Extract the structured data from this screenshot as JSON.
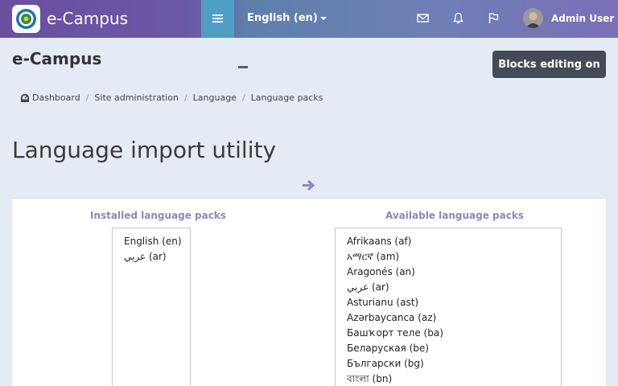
{
  "navbar": {
    "brand": "e-Campus",
    "language_menu": "English (en)",
    "user_name": "Admin User"
  },
  "header": {
    "site_title": "e-Campus",
    "blocks_button": "Blocks editing on"
  },
  "breadcrumb": [
    {
      "label": "Dashboard"
    },
    {
      "label": "Site administration"
    },
    {
      "label": "Language"
    },
    {
      "label": "Language packs"
    }
  ],
  "main": {
    "heading": "Language import utility",
    "installed": {
      "title": "Installed language packs",
      "items": [
        "English (en)",
        "عربي (ar)"
      ]
    },
    "available": {
      "title": "Available language packs",
      "items": [
        "Afrikaans (af)",
        "አማርኛ (am)",
        "Aragonés (an)",
        "عربي (ar)",
        "Asturianu (ast)",
        "Azərbaycanca (az)",
        "Башҡорт теле (ba)",
        "Беларуская (be)",
        "Български (bg)",
        "বাংলা (bn)"
      ]
    }
  },
  "icons": {
    "nav_toggle": "hamburger-icon",
    "messages": "envelope-icon",
    "notifications": "bell-icon",
    "flag": "flag-icon",
    "dashboard": "dashboard-icon",
    "add_arrow": "arrow-right-icon"
  },
  "colors": {
    "nav_start": "#6a4f9f",
    "nav_toggle": "#4e9ec6",
    "page_bg": "#e4ebf5",
    "button_dark": "#444a56",
    "column_heading": "#8c87c0"
  }
}
